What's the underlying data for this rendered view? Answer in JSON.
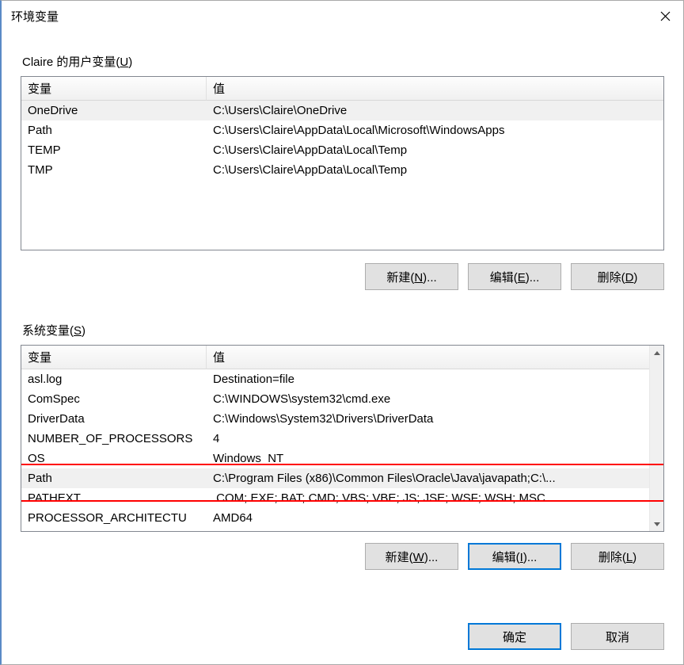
{
  "window": {
    "title": "环境变量"
  },
  "user_section": {
    "label_prefix": "Claire 的用户变量(",
    "label_mn": "U",
    "label_suffix": ")",
    "header_name": "变量",
    "header_value": "值",
    "rows": [
      {
        "name": "OneDrive",
        "value": "C:\\Users\\Claire\\OneDrive",
        "selected": true
      },
      {
        "name": "Path",
        "value": "C:\\Users\\Claire\\AppData\\Local\\Microsoft\\WindowsApps"
      },
      {
        "name": "TEMP",
        "value": "C:\\Users\\Claire\\AppData\\Local\\Temp"
      },
      {
        "name": "TMP",
        "value": "C:\\Users\\Claire\\AppData\\Local\\Temp"
      }
    ],
    "buttons": {
      "new": {
        "pre": "新建(",
        "mn": "N",
        "post": ")..."
      },
      "edit": {
        "pre": "编辑(",
        "mn": "E",
        "post": ")..."
      },
      "del": {
        "pre": "删除(",
        "mn": "D",
        "post": ")"
      }
    }
  },
  "system_section": {
    "label_prefix": "系统变量(",
    "label_mn": "S",
    "label_suffix": ")",
    "header_name": "变量",
    "header_value": "值",
    "rows": [
      {
        "name": "asl.log",
        "value": "Destination=file"
      },
      {
        "name": "ComSpec",
        "value": "C:\\WINDOWS\\system32\\cmd.exe"
      },
      {
        "name": "DriverData",
        "value": "C:\\Windows\\System32\\Drivers\\DriverData"
      },
      {
        "name": "NUMBER_OF_PROCESSORS",
        "value": "4"
      },
      {
        "name": "OS",
        "value": "Windows_NT"
      },
      {
        "name": "Path",
        "value": "C:\\Program Files (x86)\\Common Files\\Oracle\\Java\\javapath;C:\\...",
        "selected": true
      },
      {
        "name": "PATHEXT",
        "value": ".COM;.EXE;.BAT;.CMD;.VBS;.VBE;.JS;.JSE;.WSF;.WSH;.MSC"
      },
      {
        "name": "PROCESSOR_ARCHITECTU",
        "value": "AMD64"
      }
    ],
    "buttons": {
      "new": {
        "pre": "新建(",
        "mn": "W",
        "post": ")..."
      },
      "edit": {
        "pre": "编辑(",
        "mn": "I",
        "post": ")..."
      },
      "del": {
        "pre": "删除(",
        "mn": "L",
        "post": ")"
      }
    }
  },
  "footer": {
    "ok": "确定",
    "cancel": "取消"
  },
  "highlight": {
    "note": "red box around system Path row"
  }
}
